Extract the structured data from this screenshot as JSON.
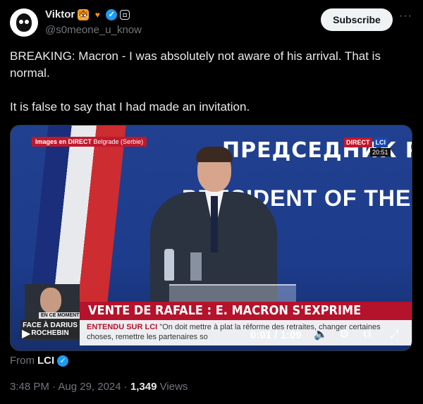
{
  "author": {
    "name": "Viktor",
    "handle": "@s0meone_u_know",
    "badges": [
      "tiger-emoji",
      "orange-heart-emoji",
      "verified-badge",
      "camera-badge"
    ]
  },
  "subscribe_label": "Subscribe",
  "more_label": "···",
  "tweet": {
    "line1": "BREAKING: Macron -  I was absolutely not aware of his arrival. That is normal.",
    "line2": "It is false to say that I had made an invitation."
  },
  "video": {
    "chip_bold": "Images en DIRECT",
    "chip_rest": " Belgrade (Serbie)",
    "wall_line1": "ПРЕДСЕДНИК РЕ",
    "wall_line2": "PRESIDENT OF THE",
    "direct_label": "DIRECT",
    "channel_label": "LCI",
    "clock": "20:51",
    "headline": "VENTE DE RAFALE : E. MACRON S'EXPRIME",
    "ticker_label": "ENTENDU SUR",
    "ticker_channel": "LCI",
    "ticker_text": "\"On doit mettre à plat la réforme des retraites, changer certaines choses, remettre les partenaires so",
    "guest_tag": "EN CE MOMENT",
    "guest_name": "FACE À DARIUS ROCHEBIN",
    "time": "0:01 / 1:09"
  },
  "source": {
    "prefix": "From",
    "name": "LCI"
  },
  "meta": {
    "time": "3:48 PM · Aug 29, 2024 · ",
    "views": "1,349",
    "views_label": " Views"
  }
}
